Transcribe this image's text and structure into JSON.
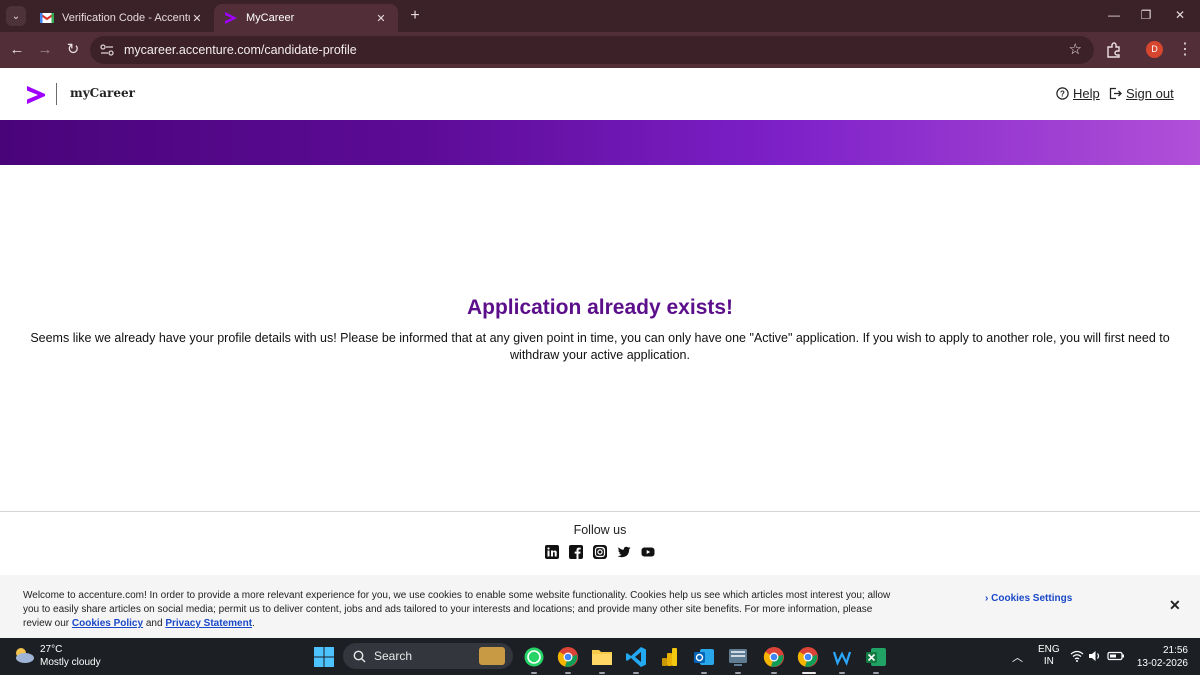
{
  "browser": {
    "tabs": [
      {
        "title": "Verification Code - Accenture -",
        "active": false,
        "close": "✕"
      },
      {
        "title": "MyCareer",
        "active": true,
        "close": "✕"
      }
    ],
    "new_tab": "+",
    "url": "mycareer.accenture.com/candidate-profile",
    "profile_initial": "D",
    "window_controls": {
      "minimize": "—",
      "maximize": "❐",
      "close": "✕"
    }
  },
  "header": {
    "brand": "myCareer",
    "help_label": "Help",
    "signout_label": "Sign out"
  },
  "main": {
    "title": "Application already exists!",
    "body": "Seems like we already have your profile details with us! Please be informed that at any given point in time, you can only have one \"Active\" application. If you wish to apply to another role, you will first need to withdraw your active application."
  },
  "footer": {
    "follow_text": "Follow us",
    "social_icons": [
      "linkedin-icon",
      "facebook-icon",
      "instagram-icon",
      "twitter-icon",
      "youtube-icon"
    ]
  },
  "cookie_banner": {
    "text": "Welcome to accenture.com! In order to provide a more relevant experience for you, we use cookies to enable some website functionality. Cookies help us see which articles most interest you; allow you to easily share articles on social media; permit us to deliver content, jobs and ads tailored to your interests and locations; and provide many other site benefits. For more information, please review our",
    "cookies_policy_link": "Cookies Policy",
    "and_text": "and",
    "privacy_link": "Privacy Statement",
    "period": ".",
    "settings_label": "Cookies Settings",
    "close_label": "✕"
  },
  "taskbar": {
    "weather_temp": "27°C",
    "weather_desc": "Mostly cloudy",
    "search_label": "Search",
    "lang_line1": "ENG",
    "lang_line2": "IN",
    "time": "21:56",
    "date": "13-02-2026"
  },
  "colors": {
    "brand_purple": "#5c0f8b",
    "link_blue": "#1a49c8",
    "chrome_tab": "#522f38"
  }
}
